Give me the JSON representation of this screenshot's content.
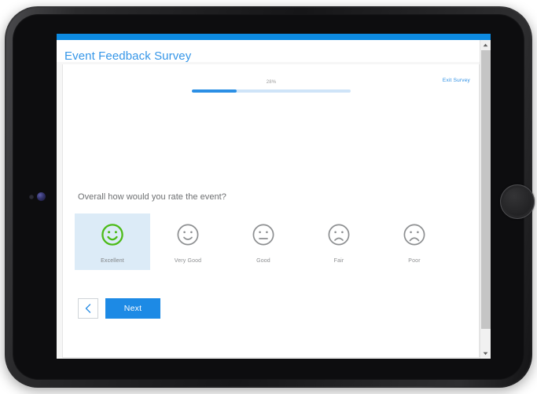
{
  "device": {
    "type": "tablet",
    "camera_icon": "camera-dot",
    "sensor_icon": "sensor-dot",
    "home_button_label": "Home"
  },
  "header": {
    "title": "Event Feedback Survey",
    "accent_color": "#0d8ae0",
    "title_color": "#3596e8"
  },
  "progress": {
    "percent_label": "28%",
    "percent_value": 28,
    "fill_color": "#2b8fe5",
    "track_color": "#cfe4f8"
  },
  "exit": {
    "label": "Exit Survey",
    "color": "#2b8fe5"
  },
  "question": {
    "text": "Overall how would you rate the event?"
  },
  "ratings": {
    "selected_index": 0,
    "selected_bg": "#dcebf7",
    "selected_face_color": "#4cbb17",
    "face_color": "#8d8f91",
    "options": [
      {
        "label": "Excellent",
        "face": "smile-big-face-icon",
        "selected": true
      },
      {
        "label": "Very Good",
        "face": "smile-face-icon",
        "selected": false
      },
      {
        "label": "Good",
        "face": "neutral-face-icon",
        "selected": false
      },
      {
        "label": "Fair",
        "face": "frown-face-icon",
        "selected": false
      },
      {
        "label": "Poor",
        "face": "frown-deep-face-icon",
        "selected": false
      }
    ]
  },
  "navigation": {
    "back_label": "chevron-left-icon",
    "next_label": "Next",
    "next_color": "#1d8ae5"
  },
  "scrollbar": {
    "up_arrow": "chevron-up-icon",
    "down_arrow": "chevron-down-icon",
    "thumb": "scroll-thumb"
  }
}
